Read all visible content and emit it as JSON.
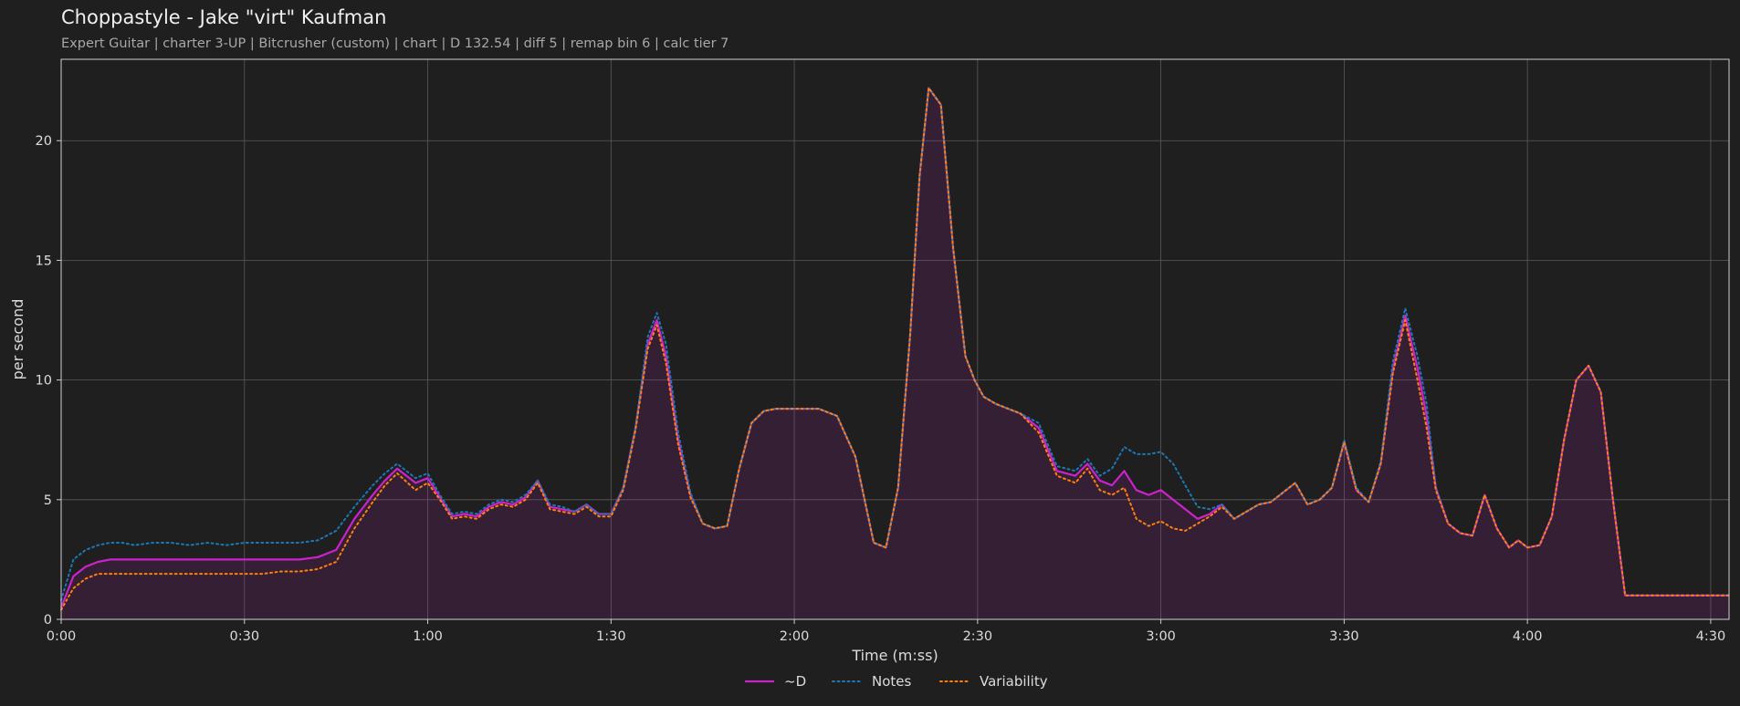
{
  "chart_data": {
    "type": "line",
    "title": "Choppastyle - Jake \"virt\" Kaufman",
    "subtitle": "Expert Guitar  |  charter 3-UP  |  Bitcrusher (custom)  |  chart  |  D 132.54  |  diff 5  |  remap bin 6  |  calc tier 7",
    "xlabel": "Time (m:ss)",
    "ylabel": "per second",
    "xlim": [
      0,
      273
    ],
    "ylim": [
      0,
      23.4
    ],
    "x_ticks": [
      0,
      30,
      60,
      90,
      120,
      150,
      180,
      210,
      240,
      270
    ],
    "x_tick_labels": [
      "0:00",
      "0:30",
      "1:00",
      "1:30",
      "2:00",
      "2:30",
      "3:00",
      "3:30",
      "4:00",
      "4:30"
    ],
    "y_ticks": [
      0,
      5,
      10,
      15,
      20
    ],
    "y_tick_labels": [
      "0",
      "5",
      "10",
      "15",
      "20"
    ],
    "grid": true,
    "legend_position": "bottom-center",
    "series": [
      {
        "name": "~D",
        "color": "#cc22cc",
        "style": "solid",
        "fill": true,
        "x": [
          0,
          2,
          4,
          6,
          8,
          10,
          12,
          15,
          18,
          21,
          24,
          27,
          30,
          33,
          36,
          39,
          42,
          45,
          48,
          51,
          53,
          55,
          58,
          60,
          62,
          64,
          66,
          68,
          70,
          72,
          74,
          76,
          78,
          80,
          82,
          84,
          86,
          88,
          90,
          92,
          94,
          96,
          97.5,
          99,
          101,
          103,
          105,
          107,
          109,
          111,
          113,
          115,
          117,
          119,
          121,
          124,
          127,
          130,
          133,
          135,
          137,
          139,
          140.5,
          142,
          144,
          146,
          148,
          149.5,
          151,
          153,
          155,
          157,
          160,
          163,
          166,
          168,
          170,
          172,
          174,
          176,
          178,
          180,
          182,
          184,
          186,
          188,
          190,
          192,
          194,
          196,
          198,
          200,
          202,
          204,
          206,
          208,
          210,
          212,
          214,
          216,
          218,
          220,
          222,
          223.5,
          225,
          227,
          229,
          231,
          233,
          235,
          237,
          238.5,
          240,
          242,
          244,
          246,
          248,
          250,
          252,
          254,
          256,
          258,
          260,
          262,
          264,
          266,
          268,
          269.5,
          271,
          272.3,
          273
        ],
        "values": [
          0.5,
          1.8,
          2.2,
          2.4,
          2.5,
          2.5,
          2.5,
          2.5,
          2.5,
          2.5,
          2.5,
          2.5,
          2.5,
          2.5,
          2.5,
          2.5,
          2.6,
          2.9,
          4.2,
          5.2,
          5.8,
          6.3,
          5.7,
          5.9,
          5.1,
          4.3,
          4.4,
          4.3,
          4.7,
          4.9,
          4.8,
          5.1,
          5.8,
          4.7,
          4.6,
          4.5,
          4.8,
          4.4,
          4.4,
          5.5,
          8.0,
          11.5,
          12.5,
          11.0,
          7.5,
          5.2,
          4.0,
          3.8,
          3.9,
          6.3,
          8.2,
          8.7,
          8.8,
          8.8,
          8.8,
          8.8,
          8.5,
          6.8,
          3.2,
          3.0,
          5.5,
          12.0,
          18.5,
          22.2,
          21.5,
          15.5,
          11.0,
          10.0,
          9.3,
          9.0,
          8.8,
          8.6,
          8.0,
          6.2,
          6.0,
          6.5,
          5.8,
          5.6,
          6.2,
          5.4,
          5.2,
          5.4,
          5.0,
          4.6,
          4.2,
          4.4,
          4.8,
          4.2,
          4.5,
          4.8,
          4.9,
          5.3,
          5.7,
          4.8,
          5.0,
          5.5,
          7.4,
          5.4,
          4.9,
          6.5,
          10.5,
          12.7,
          10.5,
          8.5,
          5.5,
          4.0,
          3.6,
          3.5,
          5.2,
          3.8,
          3.0,
          3.3,
          3.0,
          3.1,
          4.3,
          7.5,
          10.0,
          10.6,
          9.5,
          5.0,
          1.0,
          1.0,
          1.0,
          1.0,
          1.0,
          1.0,
          1.0,
          1.0,
          1.0,
          1.0,
          1.0
        ]
      },
      {
        "name": "Notes",
        "color": "#1f77b4",
        "style": "dotted",
        "x": [
          0,
          2,
          4,
          6,
          8,
          10,
          12,
          15,
          18,
          21,
          24,
          27,
          30,
          33,
          36,
          39,
          42,
          45,
          48,
          51,
          53,
          55,
          58,
          60,
          62,
          64,
          66,
          68,
          70,
          72,
          74,
          76,
          78,
          80,
          82,
          84,
          86,
          88,
          90,
          92,
          94,
          96,
          97.5,
          99,
          101,
          103,
          105,
          107,
          109,
          111,
          113,
          115,
          117,
          119,
          121,
          124,
          127,
          130,
          133,
          135,
          137,
          139,
          140.5,
          142,
          144,
          146,
          148,
          149.5,
          151,
          153,
          155,
          157,
          160,
          163,
          166,
          168,
          170,
          172,
          174,
          176,
          178,
          180,
          182,
          184,
          186,
          188,
          190,
          192,
          194,
          196,
          198,
          200,
          202,
          204,
          206,
          208,
          210,
          212,
          214,
          216,
          218,
          220,
          222,
          223.5,
          225,
          227,
          229,
          231,
          233,
          235,
          237,
          238.5,
          240,
          242,
          244,
          246,
          248,
          250,
          252,
          254,
          256,
          258,
          260,
          262,
          264,
          266,
          268,
          269.5,
          271,
          272.3,
          273
        ],
        "values": [
          0.8,
          2.5,
          2.9,
          3.1,
          3.2,
          3.2,
          3.1,
          3.2,
          3.2,
          3.1,
          3.2,
          3.1,
          3.2,
          3.2,
          3.2,
          3.2,
          3.3,
          3.7,
          4.7,
          5.6,
          6.1,
          6.5,
          5.9,
          6.1,
          5.2,
          4.4,
          4.5,
          4.4,
          4.8,
          5.0,
          4.9,
          5.2,
          5.8,
          4.8,
          4.7,
          4.5,
          4.8,
          4.4,
          4.4,
          5.5,
          8.0,
          11.8,
          12.8,
          11.5,
          7.8,
          5.3,
          4.0,
          3.8,
          3.9,
          6.3,
          8.2,
          8.7,
          8.8,
          8.8,
          8.8,
          8.8,
          8.5,
          6.8,
          3.2,
          3.0,
          5.5,
          12.0,
          18.5,
          22.2,
          21.5,
          15.5,
          11.0,
          10.0,
          9.3,
          9.0,
          8.8,
          8.6,
          8.2,
          6.4,
          6.2,
          6.7,
          6.0,
          6.3,
          7.2,
          6.9,
          6.9,
          7.0,
          6.5,
          5.6,
          4.7,
          4.6,
          4.8,
          4.2,
          4.5,
          4.8,
          4.9,
          5.3,
          5.7,
          4.8,
          5.0,
          5.5,
          7.5,
          5.5,
          4.9,
          6.6,
          10.8,
          13.0,
          11.0,
          9.0,
          5.5,
          4.0,
          3.6,
          3.5,
          5.2,
          3.8,
          3.0,
          3.3,
          3.0,
          3.1,
          4.3,
          7.5,
          10.0,
          10.6,
          9.5,
          5.0,
          1.0,
          1.0,
          1.0,
          1.0,
          1.0,
          1.0,
          1.0,
          1.0,
          1.0,
          1.0,
          1.0
        ]
      },
      {
        "name": "Variability",
        "color": "#ff7f0e",
        "style": "dotted",
        "x": [
          0,
          2,
          4,
          6,
          8,
          10,
          12,
          15,
          18,
          21,
          24,
          27,
          30,
          33,
          36,
          39,
          42,
          45,
          48,
          51,
          53,
          55,
          58,
          60,
          62,
          64,
          66,
          68,
          70,
          72,
          74,
          76,
          78,
          80,
          82,
          84,
          86,
          88,
          90,
          92,
          94,
          96,
          97.5,
          99,
          101,
          103,
          105,
          107,
          109,
          111,
          113,
          115,
          117,
          119,
          121,
          124,
          127,
          130,
          133,
          135,
          137,
          139,
          140.5,
          142,
          144,
          146,
          148,
          149.5,
          151,
          153,
          155,
          157,
          160,
          163,
          166,
          168,
          170,
          172,
          174,
          176,
          178,
          180,
          182,
          184,
          186,
          188,
          190,
          192,
          194,
          196,
          198,
          200,
          202,
          204,
          206,
          208,
          210,
          212,
          214,
          216,
          218,
          220,
          222,
          223.5,
          225,
          227,
          229,
          231,
          233,
          235,
          237,
          238.5,
          240,
          242,
          244,
          246,
          248,
          250,
          252,
          254,
          256,
          258,
          260,
          262,
          264,
          266,
          268,
          269.5,
          271,
          272.3,
          273
        ],
        "values": [
          0.4,
          1.3,
          1.7,
          1.9,
          1.9,
          1.9,
          1.9,
          1.9,
          1.9,
          1.9,
          1.9,
          1.9,
          1.9,
          1.9,
          2.0,
          2.0,
          2.1,
          2.4,
          3.8,
          4.9,
          5.6,
          6.1,
          5.4,
          5.7,
          5.0,
          4.2,
          4.3,
          4.2,
          4.6,
          4.8,
          4.7,
          5.0,
          5.7,
          4.6,
          4.5,
          4.4,
          4.7,
          4.3,
          4.3,
          5.4,
          7.9,
          11.3,
          12.3,
          10.7,
          7.3,
          5.1,
          4.0,
          3.8,
          3.9,
          6.3,
          8.2,
          8.7,
          8.8,
          8.8,
          8.8,
          8.8,
          8.5,
          6.8,
          3.2,
          3.0,
          5.5,
          12.0,
          18.5,
          22.2,
          21.5,
          15.5,
          11.0,
          10.0,
          9.3,
          9.0,
          8.8,
          8.6,
          7.8,
          6.0,
          5.7,
          6.3,
          5.4,
          5.2,
          5.5,
          4.2,
          3.9,
          4.1,
          3.8,
          3.7,
          4.0,
          4.3,
          4.7,
          4.2,
          4.5,
          4.8,
          4.9,
          5.3,
          5.7,
          4.8,
          5.0,
          5.5,
          7.4,
          5.4,
          4.9,
          6.5,
          10.3,
          12.5,
          10.0,
          8.0,
          5.4,
          4.0,
          3.6,
          3.5,
          5.2,
          3.8,
          3.0,
          3.3,
          3.0,
          3.1,
          4.3,
          7.5,
          10.0,
          10.6,
          9.5,
          5.0,
          1.0,
          1.0,
          1.0,
          1.0,
          1.0,
          1.0,
          1.0,
          1.0,
          1.0,
          1.0,
          1.0
        ]
      }
    ]
  }
}
